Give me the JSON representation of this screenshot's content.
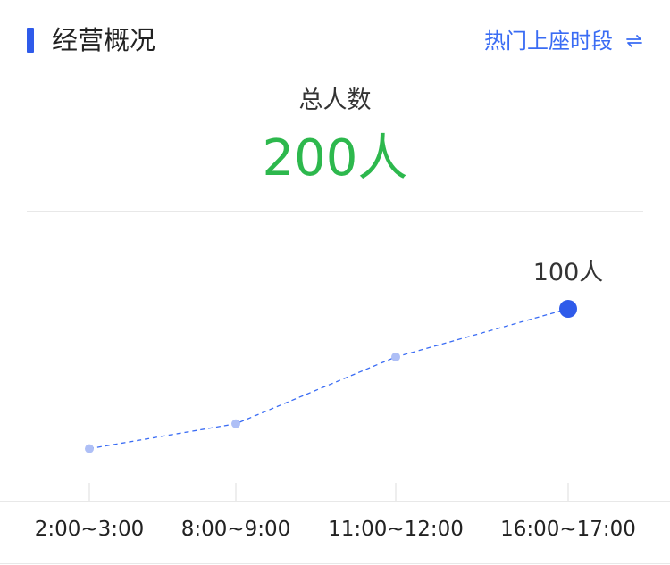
{
  "header": {
    "title": "经营概况",
    "hot_link_label": "热门上座时段",
    "switch_icon": "swap-arrows-icon"
  },
  "summary": {
    "label": "总人数",
    "value": "200人"
  },
  "colors": {
    "accent": "#2f5bea",
    "link": "#3a6cf4",
    "value_green": "#2db84d",
    "line": "#3a6cf4",
    "point_light": "#aebff6",
    "point_active": "#2f5bea"
  },
  "chart_data": {
    "type": "line",
    "categories": [
      "2:00~3:00",
      "8:00~9:00",
      "11:00~12:00",
      "16:00~17:00"
    ],
    "values": [
      10,
      26,
      69,
      100
    ],
    "ylim": [
      0,
      100
    ],
    "highlight_index": 3,
    "highlight_label": "100人",
    "line_style": "dashed",
    "grid": false
  }
}
